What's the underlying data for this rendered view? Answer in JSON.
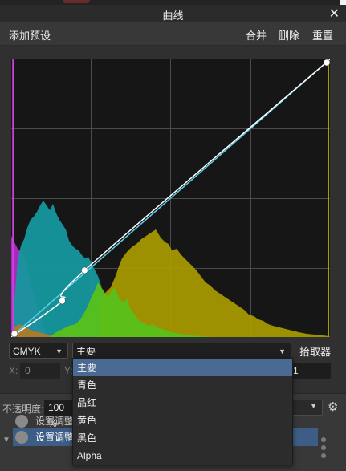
{
  "window": {
    "title": "曲线",
    "close_glyph": "✕"
  },
  "toolbar": {
    "add_preset": "添加预设",
    "merge": "合并",
    "delete": "删除",
    "reset": "重置"
  },
  "controls": {
    "color_space": "CMYK",
    "channel_selected": "主要",
    "picker_label": "拾取器",
    "x_label": "X:",
    "x_value": "0",
    "y_label": "Y:",
    "right_value": "1"
  },
  "channel_menu": {
    "options": [
      "主要",
      "青色",
      "品红",
      "黄色",
      "黑色",
      "Alpha"
    ],
    "selected_index": 0
  },
  "layers_panel": {
    "opacity_label": "不透明度:",
    "opacity_value": "100 %",
    "layers": [
      {
        "label": "设置调整",
        "selected": false
      },
      {
        "label": "设置调整",
        "selected": true
      }
    ]
  },
  "colors": {
    "master_curve": "#ffffff",
    "diagonal": "#5fcfe8",
    "cyan_hist": "#1a9aa0",
    "yellow_hist": "#b8a800",
    "green_hist": "#5bc41a",
    "magenta_hist": "#c830d8",
    "selection": "#4a6a94"
  },
  "curve": {
    "x_range": [
      0,
      1
    ],
    "y_range": [
      0,
      1
    ],
    "control_points": [
      {
        "x": 0.0,
        "y": 0.0
      },
      {
        "x": 0.16,
        "y": 0.13
      },
      {
        "x": 0.23,
        "y": 0.24
      },
      {
        "x": 1.0,
        "y": 1.0
      }
    ]
  }
}
